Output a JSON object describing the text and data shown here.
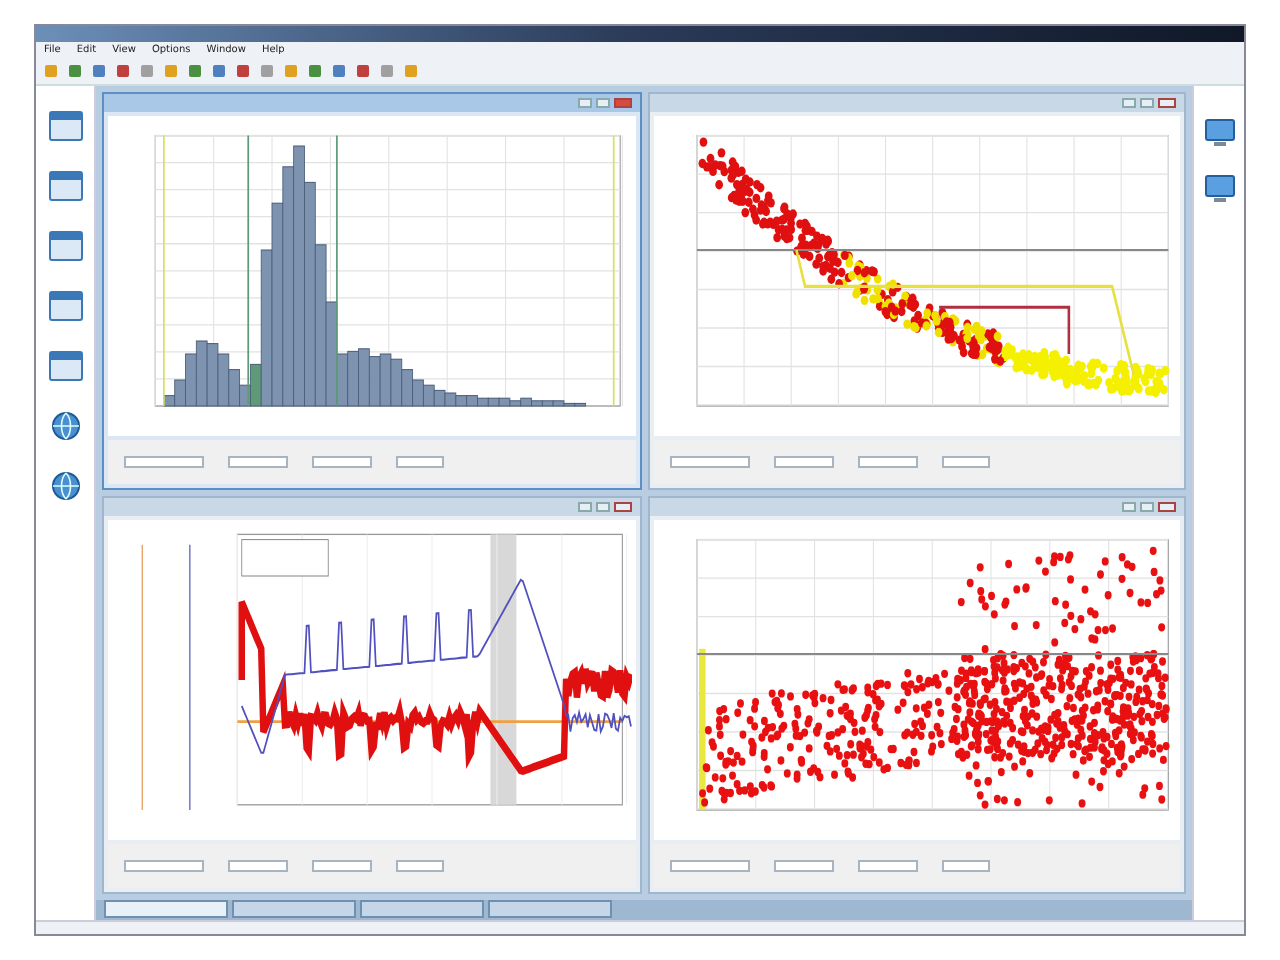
{
  "menu": [
    "File",
    "Edit",
    "View",
    "Options",
    "Window",
    "Help"
  ],
  "sidebar": {
    "items": [
      {
        "kind": "window"
      },
      {
        "kind": "window"
      },
      {
        "kind": "window"
      },
      {
        "kind": "window"
      },
      {
        "kind": "window"
      },
      {
        "kind": "globe"
      },
      {
        "kind": "globe"
      }
    ]
  },
  "right_panel": {
    "items": [
      {
        "kind": "monitor"
      },
      {
        "kind": "monitor"
      }
    ]
  },
  "windows": [
    {
      "kind": "histogram",
      "active": true
    },
    {
      "kind": "scatter-curve",
      "active": false
    },
    {
      "kind": "trend",
      "active": false
    },
    {
      "kind": "scatter-cloud",
      "active": false
    }
  ],
  "taskbar": {
    "tabs": [
      {
        "selected": true
      },
      {
        "selected": false
      },
      {
        "selected": false
      },
      {
        "selected": false
      }
    ]
  }
}
